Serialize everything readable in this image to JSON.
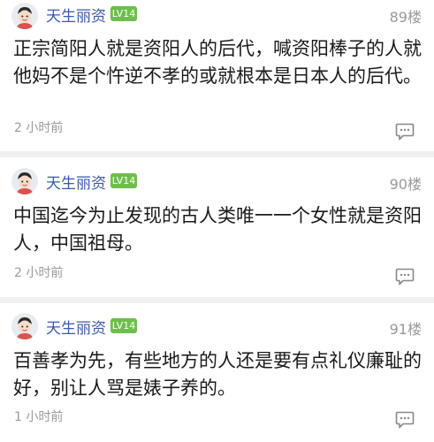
{
  "posts": [
    {
      "username": "天生丽资",
      "level": "LV14",
      "floor": "89楼",
      "content": "正宗简阳人就是资阳人的后代，喊资阳棒子的人就他妈不是个忤逆不孝的或就根本是日本人的后代。",
      "time": "2 小时前"
    },
    {
      "username": "天生丽资",
      "level": "LV14",
      "floor": "90楼",
      "content": "中国迄今为止发现的古人类唯一一个女性就是资阳人，中国祖母。",
      "time": "2 小时前"
    },
    {
      "username": "天生丽资",
      "level": "LV14",
      "floor": "91楼",
      "content": "百善孝为先，有些地方的人还是要有点礼仪廉耻的好，别让人骂是婊子养的。",
      "time": "1 小时前"
    }
  ],
  "icons": {
    "avatar": "avatar-icon",
    "comment": "comment-bubble-icon"
  },
  "colors": {
    "username": "#3a5ba6",
    "level_badge": "#6cbf4b",
    "separator": "#f0f0f0"
  }
}
